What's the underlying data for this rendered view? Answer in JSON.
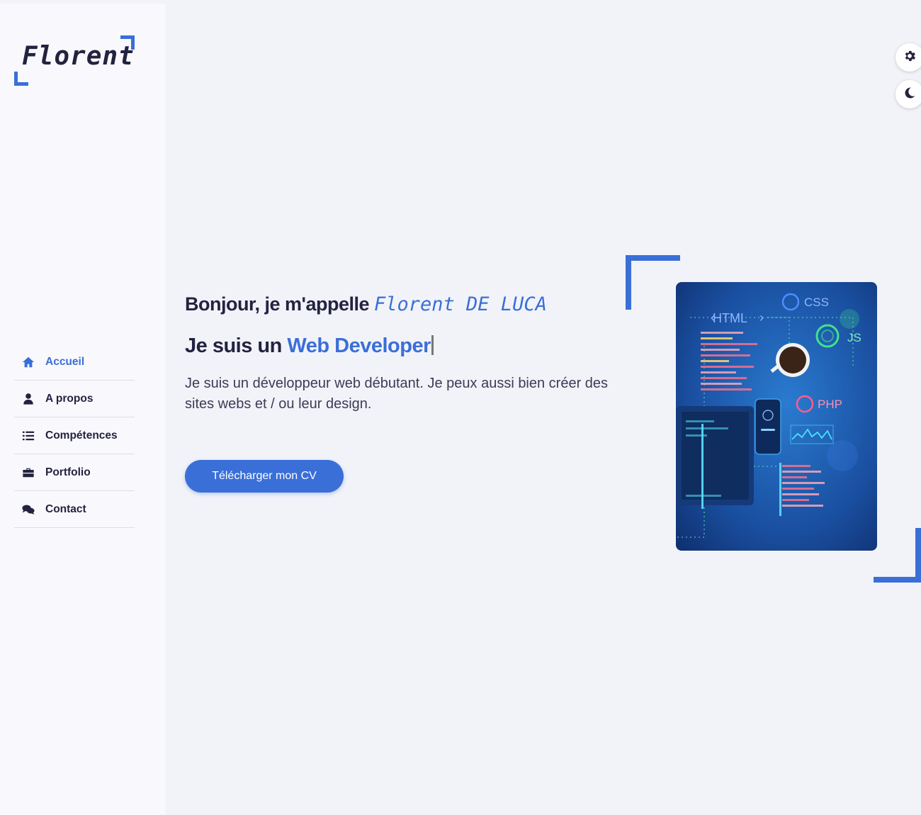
{
  "logo": {
    "text": "Florent"
  },
  "nav": {
    "items": [
      {
        "label": "Accueil",
        "icon": "home-icon",
        "active": true
      },
      {
        "label": "A propos",
        "icon": "user-icon",
        "active": false
      },
      {
        "label": "Compétences",
        "icon": "list-icon",
        "active": false
      },
      {
        "label": "Portfolio",
        "icon": "briefcase-icon",
        "active": false
      },
      {
        "label": "Contact",
        "icon": "comments-icon",
        "active": false
      }
    ]
  },
  "controls": {
    "settings_icon": "gear-icon",
    "theme_icon": "moon-icon"
  },
  "hero": {
    "greeting_prefix": "Bonjour, je m'appelle",
    "name": "Florent DE LUCA",
    "role_prefix": "Je suis un",
    "role": "Web Developer",
    "description": "Je suis un développeur web débutant. Je peux aussi bien créer des sites webs et / ou leur design.",
    "cv_button": "Télécharger mon CV"
  },
  "illustration": {
    "labels": [
      "CSS",
      "HTML",
      "JS",
      "PHP"
    ],
    "html_label": "HTML"
  },
  "colors": {
    "accent": "#3a6fd8",
    "text": "#232340",
    "background": "#f2f3f9",
    "sidebar": "#f9f9fd"
  }
}
